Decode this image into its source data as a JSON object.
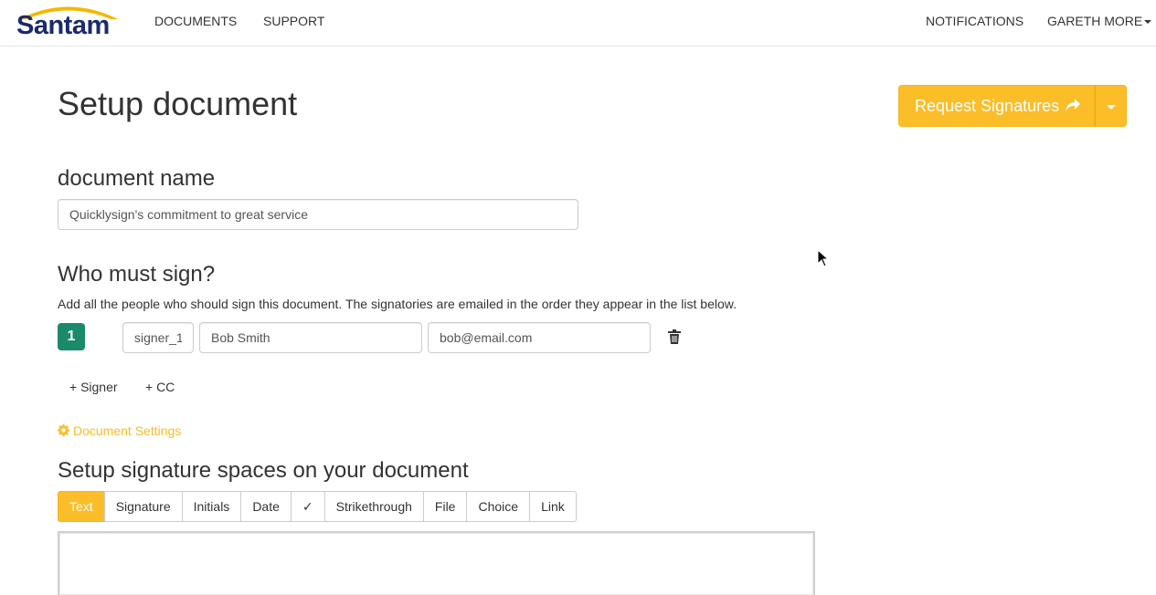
{
  "brand": {
    "logo_text": "Santam",
    "logo_color": "#1b2a6e",
    "arc_color": "#f5b700"
  },
  "nav": {
    "left_items": [
      "DOCUMENTS",
      "SUPPORT"
    ],
    "notifications": "NOTIFICATIONS",
    "user": "GARETH MORE"
  },
  "page": {
    "title": "Setup document",
    "primary_button": {
      "label": "Request Signatures",
      "icon": "share-arrow-icon",
      "color": "#fbbd28"
    }
  },
  "document_name": {
    "heading": "document name",
    "value": "Quicklysign's commitment to great service"
  },
  "signers": {
    "heading": "Who must sign?",
    "help": "Add all the people who should sign this document. The signatories are emailed in the order they appear in the list below.",
    "rows": [
      {
        "order": "1",
        "role": "signer_1",
        "name": "Bob Smith",
        "email": "bob@email.com"
      }
    ],
    "add_signer": "+ Signer",
    "add_cc": "+ CC",
    "badge_color": "#1a8a6a"
  },
  "settings_link": {
    "label": "Document Settings",
    "icon": "gear-icon"
  },
  "signature_spaces": {
    "heading": "Setup signature spaces on your document",
    "tools": [
      "Text",
      "Signature",
      "Initials",
      "Date",
      "✓",
      "Strikethrough",
      "File",
      "Choice",
      "Link"
    ],
    "active_tool": "Text"
  }
}
